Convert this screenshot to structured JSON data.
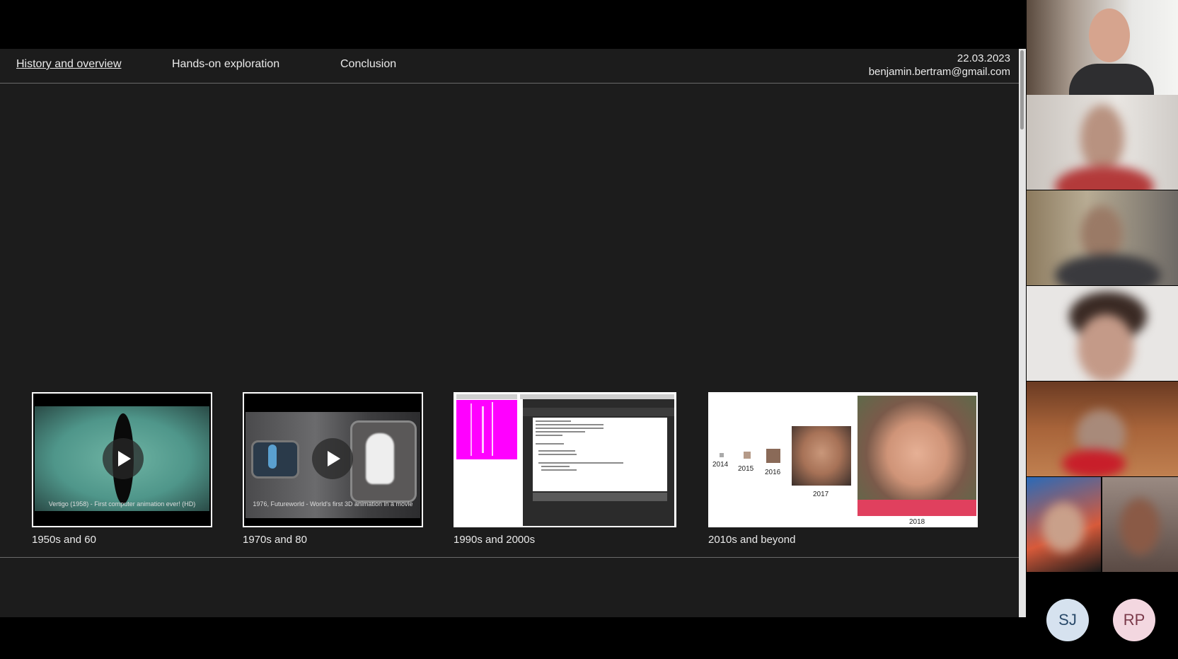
{
  "nav": {
    "tabs": [
      {
        "label": "History and overview",
        "active": true
      },
      {
        "label": "Hands-on exploration",
        "active": false
      },
      {
        "label": "Conclusion",
        "active": false
      }
    ],
    "date": "22.03.2023",
    "email": "benjamin.bertram@gmail.com"
  },
  "eras": [
    {
      "label": "1950s and 60",
      "caption": "Vertigo (1958) - First computer animation ever! (HD)"
    },
    {
      "label": "1970s and 80",
      "caption": "1976, Futureworld - World's first 3D animation in a movie"
    },
    {
      "label": "1990s and 2000s"
    },
    {
      "label": "2010s and beyond",
      "years": [
        "2014",
        "2015",
        "2016",
        "2017",
        "2018"
      ]
    }
  ],
  "participants": {
    "avatars": [
      {
        "initials": "SJ",
        "color": "#d6e2ef"
      },
      {
        "initials": "RP",
        "color": "#f3d7e0"
      }
    ]
  },
  "colors": {
    "slide_bg": "#1c1c1c",
    "processing_magenta": "#ff00ff"
  }
}
